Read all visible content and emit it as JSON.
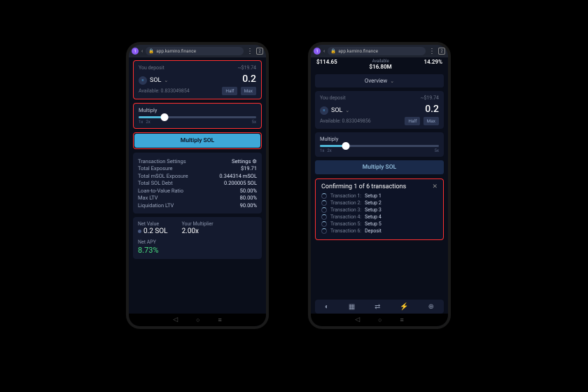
{
  "browser": {
    "url": "app.kamino.finance",
    "tab_count": "2"
  },
  "left": {
    "deposit": {
      "label": "You deposit",
      "usd": "~$19.74",
      "token": "SOL",
      "amount": "0.2",
      "available_label": "Available:",
      "available_value": "0.833049854",
      "half": "Half",
      "max": "Max"
    },
    "multiply": {
      "label": "Multiply",
      "tick_min": "1x",
      "tick_2x": "2x",
      "tick_max": "5x",
      "fill_pct": 22
    },
    "action_label": "Multiply SOL",
    "stats": {
      "settings_label": "Transaction Settings",
      "settings_link": "Settings",
      "rows": [
        {
          "label": "Total Exposure",
          "value": "$19.71",
          "cls": ""
        },
        {
          "label": "Total mSOL Exposure",
          "value": "0.344314 mSOL",
          "cls": ""
        },
        {
          "label": "Total SOL Debt",
          "value": "0.200005 SOL",
          "cls": ""
        },
        {
          "label": "Loan-to-Value Ratio",
          "value": "50.00%",
          "cls": "green"
        },
        {
          "label": "Max LTV",
          "value": "80.00%",
          "cls": "orange"
        },
        {
          "label": "Liquidation LTV",
          "value": "90.00%",
          "cls": "red"
        }
      ]
    },
    "summary": {
      "net_value_label": "Net Value",
      "net_value": "0.2 SOL",
      "multiplier_label": "Your Multiplier",
      "multiplier": "2.00x",
      "apy_label": "Net APY",
      "apy": "8.73%"
    }
  },
  "right": {
    "metrics": [
      {
        "value": "$114.65",
        "label": ""
      },
      {
        "value": "$16.80M",
        "label": "Available"
      },
      {
        "value": "14.29%",
        "label": ""
      }
    ],
    "overview": "Overview",
    "deposit": {
      "label": "You deposit",
      "usd": "~$19.74",
      "token": "SOL",
      "amount": "0.2",
      "available_label": "Available:",
      "available_value": "0.833049856",
      "half": "Half",
      "max": "Max"
    },
    "multiply": {
      "label": "Multiply",
      "tick_min": "1x",
      "tick_2x": "2x",
      "tick_max": "5x",
      "fill_pct": 22
    },
    "action_label": "Multiply SOL",
    "confirm": {
      "title": "Confirming 1 of 6 transactions",
      "items": [
        {
          "label": "Transaction 1:",
          "name": "Setup 1"
        },
        {
          "label": "Transaction 2:",
          "name": "Setup 2"
        },
        {
          "label": "Transaction 3:",
          "name": "Setup 3"
        },
        {
          "label": "Transaction 4:",
          "name": "Setup 4"
        },
        {
          "label": "Transaction 5:",
          "name": "Setup 5"
        },
        {
          "label": "Transaction 6:",
          "name": "Deposit"
        }
      ]
    },
    "nav_icons": [
      "coin",
      "grid",
      "swap",
      "bolt",
      "globe"
    ]
  }
}
